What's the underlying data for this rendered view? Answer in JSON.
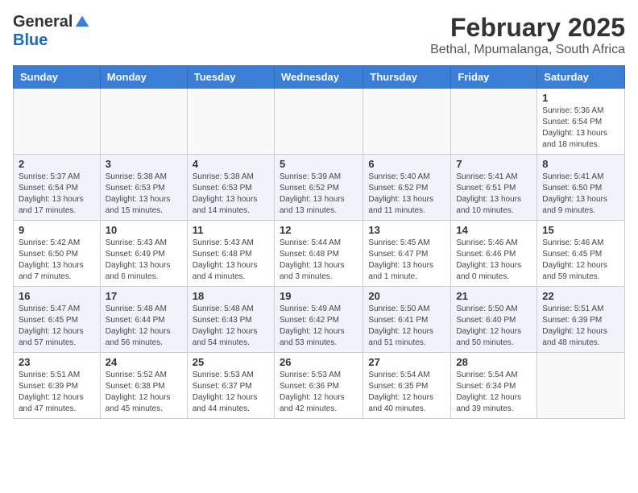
{
  "logo": {
    "general": "General",
    "blue": "Blue"
  },
  "header": {
    "month_year": "February 2025",
    "location": "Bethal, Mpumalanga, South Africa"
  },
  "weekdays": [
    "Sunday",
    "Monday",
    "Tuesday",
    "Wednesday",
    "Thursday",
    "Friday",
    "Saturday"
  ],
  "weeks": [
    [
      {
        "day": "",
        "info": ""
      },
      {
        "day": "",
        "info": ""
      },
      {
        "day": "",
        "info": ""
      },
      {
        "day": "",
        "info": ""
      },
      {
        "day": "",
        "info": ""
      },
      {
        "day": "",
        "info": ""
      },
      {
        "day": "1",
        "info": "Sunrise: 5:36 AM\nSunset: 6:54 PM\nDaylight: 13 hours and 18 minutes."
      }
    ],
    [
      {
        "day": "2",
        "info": "Sunrise: 5:37 AM\nSunset: 6:54 PM\nDaylight: 13 hours and 17 minutes."
      },
      {
        "day": "3",
        "info": "Sunrise: 5:38 AM\nSunset: 6:53 PM\nDaylight: 13 hours and 15 minutes."
      },
      {
        "day": "4",
        "info": "Sunrise: 5:38 AM\nSunset: 6:53 PM\nDaylight: 13 hours and 14 minutes."
      },
      {
        "day": "5",
        "info": "Sunrise: 5:39 AM\nSunset: 6:52 PM\nDaylight: 13 hours and 13 minutes."
      },
      {
        "day": "6",
        "info": "Sunrise: 5:40 AM\nSunset: 6:52 PM\nDaylight: 13 hours and 11 minutes."
      },
      {
        "day": "7",
        "info": "Sunrise: 5:41 AM\nSunset: 6:51 PM\nDaylight: 13 hours and 10 minutes."
      },
      {
        "day": "8",
        "info": "Sunrise: 5:41 AM\nSunset: 6:50 PM\nDaylight: 13 hours and 9 minutes."
      }
    ],
    [
      {
        "day": "9",
        "info": "Sunrise: 5:42 AM\nSunset: 6:50 PM\nDaylight: 13 hours and 7 minutes."
      },
      {
        "day": "10",
        "info": "Sunrise: 5:43 AM\nSunset: 6:49 PM\nDaylight: 13 hours and 6 minutes."
      },
      {
        "day": "11",
        "info": "Sunrise: 5:43 AM\nSunset: 6:48 PM\nDaylight: 13 hours and 4 minutes."
      },
      {
        "day": "12",
        "info": "Sunrise: 5:44 AM\nSunset: 6:48 PM\nDaylight: 13 hours and 3 minutes."
      },
      {
        "day": "13",
        "info": "Sunrise: 5:45 AM\nSunset: 6:47 PM\nDaylight: 13 hours and 1 minute."
      },
      {
        "day": "14",
        "info": "Sunrise: 5:46 AM\nSunset: 6:46 PM\nDaylight: 13 hours and 0 minutes."
      },
      {
        "day": "15",
        "info": "Sunrise: 5:46 AM\nSunset: 6:45 PM\nDaylight: 12 hours and 59 minutes."
      }
    ],
    [
      {
        "day": "16",
        "info": "Sunrise: 5:47 AM\nSunset: 6:45 PM\nDaylight: 12 hours and 57 minutes."
      },
      {
        "day": "17",
        "info": "Sunrise: 5:48 AM\nSunset: 6:44 PM\nDaylight: 12 hours and 56 minutes."
      },
      {
        "day": "18",
        "info": "Sunrise: 5:48 AM\nSunset: 6:43 PM\nDaylight: 12 hours and 54 minutes."
      },
      {
        "day": "19",
        "info": "Sunrise: 5:49 AM\nSunset: 6:42 PM\nDaylight: 12 hours and 53 minutes."
      },
      {
        "day": "20",
        "info": "Sunrise: 5:50 AM\nSunset: 6:41 PM\nDaylight: 12 hours and 51 minutes."
      },
      {
        "day": "21",
        "info": "Sunrise: 5:50 AM\nSunset: 6:40 PM\nDaylight: 12 hours and 50 minutes."
      },
      {
        "day": "22",
        "info": "Sunrise: 5:51 AM\nSunset: 6:39 PM\nDaylight: 12 hours and 48 minutes."
      }
    ],
    [
      {
        "day": "23",
        "info": "Sunrise: 5:51 AM\nSunset: 6:39 PM\nDaylight: 12 hours and 47 minutes."
      },
      {
        "day": "24",
        "info": "Sunrise: 5:52 AM\nSunset: 6:38 PM\nDaylight: 12 hours and 45 minutes."
      },
      {
        "day": "25",
        "info": "Sunrise: 5:53 AM\nSunset: 6:37 PM\nDaylight: 12 hours and 44 minutes."
      },
      {
        "day": "26",
        "info": "Sunrise: 5:53 AM\nSunset: 6:36 PM\nDaylight: 12 hours and 42 minutes."
      },
      {
        "day": "27",
        "info": "Sunrise: 5:54 AM\nSunset: 6:35 PM\nDaylight: 12 hours and 40 minutes."
      },
      {
        "day": "28",
        "info": "Sunrise: 5:54 AM\nSunset: 6:34 PM\nDaylight: 12 hours and 39 minutes."
      },
      {
        "day": "",
        "info": ""
      }
    ]
  ]
}
